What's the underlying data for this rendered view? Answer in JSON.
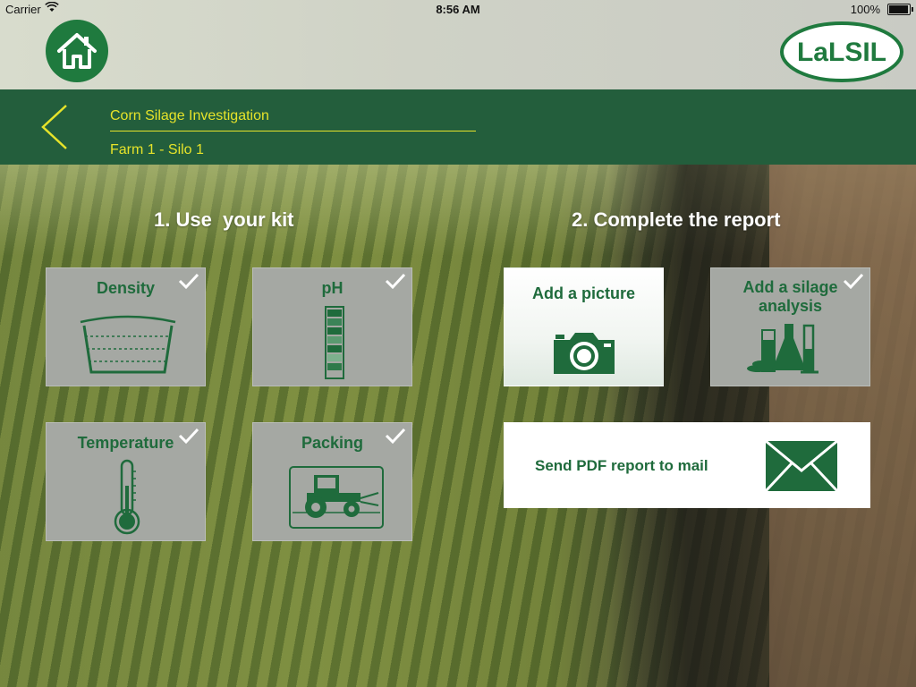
{
  "status_bar": {
    "carrier": "Carrier",
    "time": "8:56 AM",
    "battery": "100%"
  },
  "header": {
    "logo_text": "LaLSIL"
  },
  "nav": {
    "title": "Corn Silage Investigation",
    "subtitle": "Farm 1 - Silo 1"
  },
  "sections": {
    "kit_heading": "1. Use  your kit",
    "report_heading": "2. Complete the report"
  },
  "kit_tiles": [
    {
      "label": "Density",
      "icon": "density-icon",
      "checked": true
    },
    {
      "label": "pH",
      "icon": "ph-strip-icon",
      "checked": true
    },
    {
      "label": "Temperature",
      "icon": "thermometer-icon",
      "checked": true
    },
    {
      "label": "Packing",
      "icon": "tractor-icon",
      "checked": true
    }
  ],
  "report_tiles": {
    "picture": {
      "label": "Add a picture",
      "icon": "camera-icon"
    },
    "analysis": {
      "label_line1": "Add a silage",
      "label_line2": "analysis",
      "icon": "lab-flask-icon",
      "checked": true
    },
    "send": {
      "label": "Send PDF report to mail",
      "icon": "mail-envelope-icon"
    }
  },
  "colors": {
    "brand_green": "#1f6b3c",
    "nav_bg": "#235e3c",
    "nav_text": "#e6e32a",
    "tile_gray": "#a5a8a3"
  }
}
